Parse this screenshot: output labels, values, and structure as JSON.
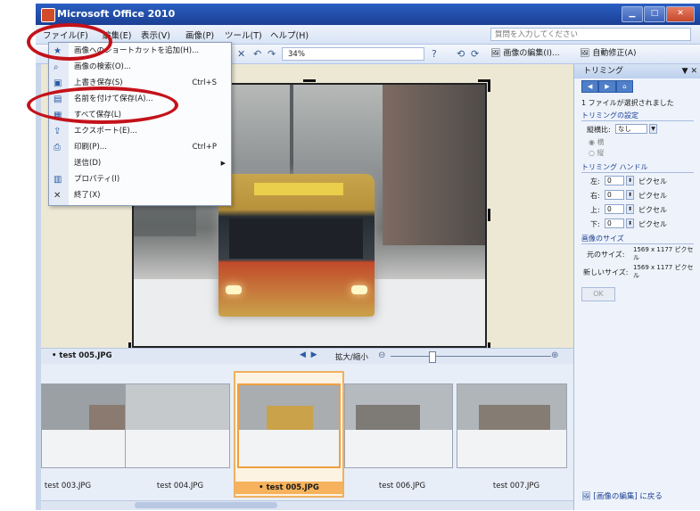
{
  "window": {
    "title": "Microsoft Office 2010"
  },
  "menubar": {
    "items": [
      "ファイル(F)",
      "編集(E)",
      "表示(V)",
      "画像(P)",
      "ツール(T)",
      "ヘルプ(H)"
    ],
    "help_placeholder": "質問を入力してください"
  },
  "toolbar": {
    "zoom": "34%",
    "edit_label": "画像の編集(I)...",
    "auto_label": "自動修正(A)"
  },
  "file_menu": {
    "items": [
      {
        "label": "画像へのショートカットを追加(H)...",
        "shortcut": ""
      },
      {
        "label": "画像の検索(O)...",
        "shortcut": ""
      },
      {
        "label": "上書き保存(S)",
        "shortcut": "Ctrl+S"
      },
      {
        "label": "名前を付けて保存(A)...",
        "shortcut": ""
      },
      {
        "label": "すべて保存(L)",
        "shortcut": ""
      },
      {
        "label": "エクスポート(E)...",
        "shortcut": ""
      },
      {
        "label": "印刷(P)...",
        "shortcut": "Ctrl+P"
      },
      {
        "label": "送信(D)",
        "shortcut": ""
      },
      {
        "label": "プロパティ(I)",
        "shortcut": ""
      },
      {
        "label": "終了(X)",
        "shortcut": ""
      }
    ]
  },
  "viewer": {
    "current_file": "• test 005.JPG",
    "zoom_label": "拡大/縮小"
  },
  "filmstrip": {
    "items": [
      {
        "name": "test 003.JPG",
        "selected": false
      },
      {
        "name": "test 004.JPG",
        "selected": false
      },
      {
        "name": "• test 005.JPG",
        "selected": true
      },
      {
        "name": "test 006.JPG",
        "selected": false
      },
      {
        "name": "test 007.JPG",
        "selected": false
      }
    ]
  },
  "panel": {
    "title": "トリミング",
    "status": "1 ファイルが選択されました",
    "settings_header": "トリミングの設定",
    "aspect_label": "縦横比:",
    "aspect_value": "なし",
    "landscape": "横",
    "portrait": "縦",
    "handles_header": "トリミング ハンドル",
    "handles": [
      {
        "label": "左:",
        "value": "0",
        "unit": "ピクセル"
      },
      {
        "label": "右:",
        "value": "0",
        "unit": "ピクセル"
      },
      {
        "label": "上:",
        "value": "0",
        "unit": "ピクセル"
      },
      {
        "label": "下:",
        "value": "0",
        "unit": "ピクセル"
      }
    ],
    "size_header": "画像のサイズ",
    "original_label": "元のサイズ:",
    "original_value": "1569 x 1177 ピクセル",
    "new_label": "新しいサイズ:",
    "new_value": "1569 x 1177 ピクセル",
    "ok": "OK",
    "back_link": "[画像の編集] に戻る"
  },
  "colors": {
    "accent": "#2b5aa6",
    "highlight_ring": "#c4121a",
    "selection": "#f6b25c"
  }
}
